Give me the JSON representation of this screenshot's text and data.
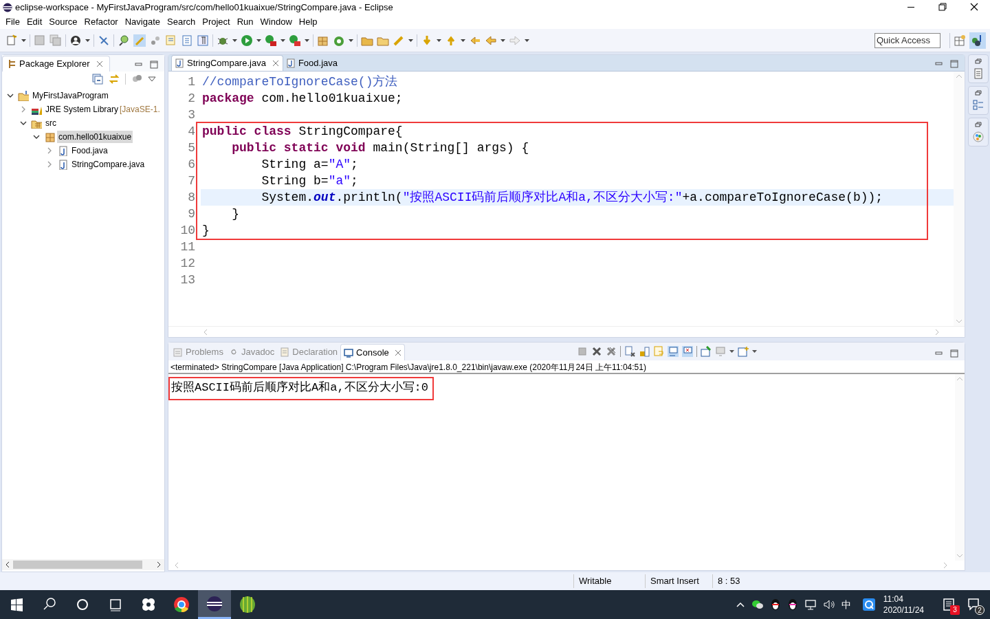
{
  "window": {
    "title": "eclipse-workspace - MyFirstJavaProgram/src/com/hello01kuaixue/StringCompare.java - Eclipse"
  },
  "menu": [
    "File",
    "Edit",
    "Source",
    "Refactor",
    "Navigate",
    "Search",
    "Project",
    "Run",
    "Window",
    "Help"
  ],
  "quick_access": {
    "placeholder": "Quick Access"
  },
  "package_explorer": {
    "title": "Package Explorer",
    "tree": [
      {
        "kind": "project",
        "label": "MyFirstJavaProgram",
        "expanded": true,
        "selected": false,
        "children": [
          {
            "kind": "library",
            "label": "JRE System Library",
            "decoration": "[JavaSE-1.",
            "expanded": false,
            "selected": false
          },
          {
            "kind": "source",
            "label": "src",
            "expanded": true,
            "selected": false,
            "children": [
              {
                "kind": "package",
                "label": "com.hello01kuaixue",
                "expanded": true,
                "selected": true,
                "children": [
                  {
                    "kind": "file",
                    "label": "Food.java",
                    "expanded": false,
                    "selected": false
                  },
                  {
                    "kind": "file",
                    "label": "StringCompare.java",
                    "expanded": false,
                    "selected": false
                  }
                ]
              }
            ]
          }
        ]
      }
    ]
  },
  "editor": {
    "tabs": [
      {
        "label": "StringCompare.java",
        "selected": true
      },
      {
        "label": "Food.java",
        "selected": false
      }
    ],
    "blocks": [
      {
        "boxed": false,
        "lines": [
          {
            "number": "1",
            "current": false,
            "tokens": [
              {
                "kind": "comment",
                "text": "//compareToIgnoreCase()方法"
              }
            ]
          },
          {
            "number": "2",
            "current": false,
            "tokens": [
              {
                "kind": "keyword",
                "text": "package"
              },
              {
                "kind": "plain",
                "text": " com.hello01kuaixue;"
              }
            ]
          },
          {
            "number": "3",
            "current": false
          }
        ]
      },
      {
        "boxed": true,
        "lines": [
          {
            "number": "4",
            "current": false,
            "tokens": [
              {
                "kind": "keyword",
                "text": "public class"
              },
              {
                "kind": "plain",
                "text": " StringCompare{"
              }
            ]
          },
          {
            "number": "5",
            "current": false,
            "tokens": [
              {
                "kind": "keyword",
                "text": "    public static void"
              },
              {
                "kind": "plain",
                "text": " main(String[] args) {"
              }
            ]
          },
          {
            "number": "6",
            "current": false,
            "tokens": [
              {
                "kind": "plain",
                "text": "        String a="
              },
              {
                "kind": "string",
                "text": "\"A\""
              },
              {
                "kind": "plain",
                "text": ";"
              }
            ]
          },
          {
            "number": "7",
            "current": false,
            "tokens": [
              {
                "kind": "plain",
                "text": "        String b="
              },
              {
                "kind": "string",
                "text": "\"a\""
              },
              {
                "kind": "plain",
                "text": ";"
              }
            ]
          },
          {
            "number": "8",
            "current": true,
            "tokens": [
              {
                "kind": "plain",
                "text": "        System."
              },
              {
                "kind": "field",
                "text": "out"
              },
              {
                "kind": "plain",
                "text": ".println("
              },
              {
                "kind": "string",
                "text": "\"按照ASCII码前后顺序对比A和a,不区分大小写:\""
              },
              {
                "kind": "plain",
                "text": "+a.compareToIgnoreCase(b));"
              }
            ]
          },
          {
            "number": "9",
            "current": false,
            "tokens": [
              {
                "kind": "plain",
                "text": "    }"
              }
            ]
          },
          {
            "number": "10",
            "current": false,
            "tokens": [
              {
                "kind": "plain",
                "text": "}"
              }
            ]
          }
        ]
      },
      {
        "boxed": false,
        "lines": [
          {
            "number": "11",
            "current": false
          },
          {
            "number": "12",
            "current": false
          },
          {
            "number": "13",
            "current": false
          }
        ]
      }
    ]
  },
  "console": {
    "tabs": [
      {
        "kind": "problems",
        "label": "Problems",
        "selected": false
      },
      {
        "kind": "javadoc",
        "label": "Javadoc",
        "selected": false
      },
      {
        "kind": "declaration",
        "label": "Declaration",
        "selected": false
      },
      {
        "kind": "console",
        "label": "Console",
        "selected": true
      }
    ],
    "status": "<terminated> StringCompare [Java Application] C:\\Program Files\\Java\\jre1.8.0_221\\bin\\javaw.exe (2020年11月24日 上午11:04:51)",
    "output": [
      {
        "text": "按照ASCII码前后顺序对比A和a,不区分大小写:0",
        "boxed": true
      }
    ]
  },
  "status_bar": [
    "Writable",
    "Smart Insert",
    "8 : 53"
  ],
  "taskbar": {
    "input_method": "中",
    "time": "11:04",
    "date": "2020/11/24",
    "badges": [
      "3",
      "2"
    ]
  }
}
